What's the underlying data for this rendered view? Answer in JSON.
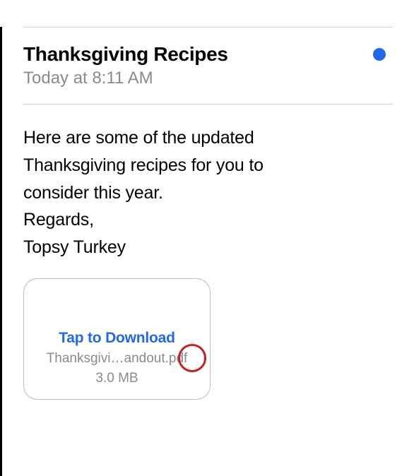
{
  "email": {
    "subject": "Thanksgiving Recipes",
    "timestamp": "Today at 8:11 AM",
    "body_line1": "Here are some of the updated",
    "body_line2": "Thanksgiving recipes for you to",
    "body_line3": "consider this year.",
    "body_line4": "Regards,",
    "body_line5": "Topsy Turkey"
  },
  "attachment": {
    "action_label": "Tap to Download",
    "filename": "Thanksgivi…andout.pdf",
    "size": "3.0 MB"
  }
}
